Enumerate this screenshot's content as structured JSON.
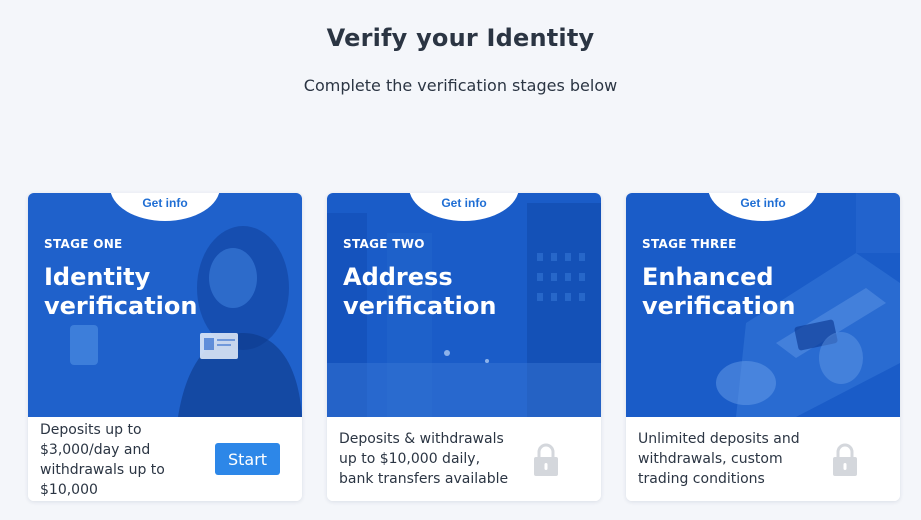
{
  "page": {
    "title": "Verify your Identity",
    "subtitle": "Complete the verification stages below"
  },
  "colors": {
    "background": "#f4f6fa",
    "card_overlay": "#1a5cc8",
    "accent": "#2d87e8",
    "link": "#1f6ed4",
    "text": "#2b3543",
    "lock": "#d4d7dc"
  },
  "cards": [
    {
      "info_link": "Get info",
      "stage": "STAGE ONE",
      "title": "Identity verification",
      "description": "Deposits up to $3,000/day and withdrawals up to $10,000",
      "action": "Start",
      "image_icon": "woman-holding-id-photo"
    },
    {
      "info_link": "Get info",
      "stage": "STAGE TWO",
      "title": "Address verification",
      "description": "Deposits & withdrawals up to $10,000 daily, bank transfers available",
      "status_icon": "lock-icon",
      "image_icon": "city-street-photo"
    },
    {
      "info_link": "Get info",
      "stage": "STAGE THREE",
      "title": "Enhanced verification",
      "description": "Unlimited deposits and withdrawals, custom trading conditions",
      "status_icon": "lock-icon",
      "image_icon": "laptop-card-photo"
    }
  ]
}
